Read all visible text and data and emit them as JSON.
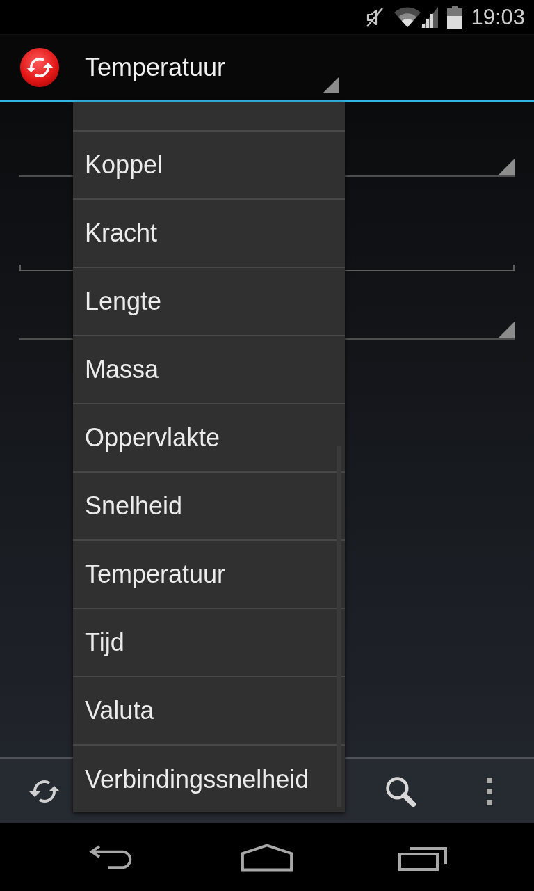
{
  "status_bar": {
    "time": "19:03"
  },
  "action_bar": {
    "title": "Temperatuur"
  },
  "form": {
    "fields": [
      {
        "kind": "spinner"
      },
      {
        "kind": "text"
      },
      {
        "kind": "spinner"
      }
    ]
  },
  "dropdown": {
    "items": [
      "Koppel",
      "Kracht",
      "Lengte",
      "Massa",
      "Oppervlakte",
      "Snelheid",
      "Temperatuur",
      "Tijd",
      "Valuta",
      "Verbindingssnelheid"
    ]
  }
}
